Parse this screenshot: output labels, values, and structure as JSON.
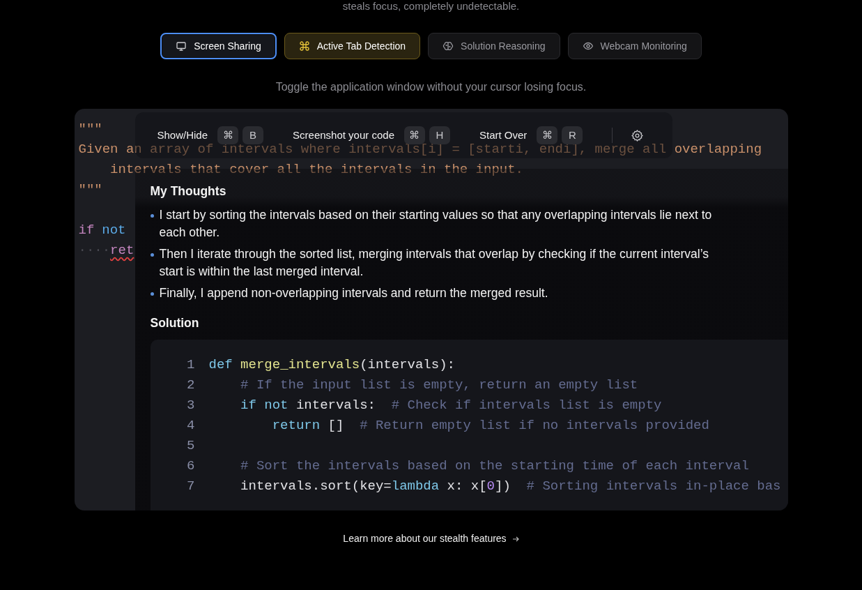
{
  "intro_tail": "steals focus, completely undetectable.",
  "tabs": [
    {
      "label": "Screen Sharing",
      "selected": false,
      "focused": true
    },
    {
      "label": "Active Tab Detection",
      "selected": true,
      "focused": false
    },
    {
      "label": "Solution Reasoning",
      "selected": false,
      "focused": false
    },
    {
      "label": "Webcam Monitoring",
      "selected": false,
      "focused": false
    }
  ],
  "caption": "Toggle the application window without your cursor losing focus.",
  "editor": {
    "docstring": [
      "\"\"\"",
      "Given an array of intervals where intervals[i] = [starti, endi], merge all overlapping",
      "    intervals that cover all the intervals in the input.",
      "\"\"\""
    ],
    "code": [
      [
        {
          "text": "if",
          "kind": "keyword2"
        },
        {
          "text": "not",
          "kind": "keyword"
        }
      ],
      [
        {
          "text": "····",
          "kind": "whitespace"
        },
        {
          "text": "ret",
          "kind": "keyword2",
          "error": true
        }
      ]
    ]
  },
  "toolbar": [
    {
      "label": "Show/Hide",
      "keys": [
        "⌘",
        "B"
      ]
    },
    {
      "label": "Screenshot your code",
      "keys": [
        "⌘",
        "H"
      ]
    },
    {
      "label": "Start Over",
      "keys": [
        "⌘",
        "R"
      ]
    }
  ],
  "thoughts": {
    "title": "My Thoughts",
    "items": [
      "I start by sorting the intervals based on their starting values so that any overlapping intervals lie next to each other.",
      "Then I iterate through the sorted list, merging intervals that overlap by checking if the current interval’s start is within the last merged interval.",
      "Finally, I append non-overlapping intervals and return the merged result."
    ]
  },
  "solution": {
    "title": "Solution",
    "lines": [
      {
        "number": "1",
        "tokens": [
          {
            "text": "def",
            "kind": "keyword"
          },
          {
            "text": " merge_intervals",
            "kind": "function"
          },
          {
            "text": "(intervals):",
            "kind": "plain"
          }
        ]
      },
      {
        "number": "2",
        "tokens": [
          {
            "text": "    # If the input list is empty, return an empty list",
            "kind": "comment"
          }
        ]
      },
      {
        "number": "3",
        "tokens": [
          {
            "text": "    if not",
            "kind": "keyword"
          },
          {
            "text": " intervals:  ",
            "kind": "plain"
          },
          {
            "text": "# Check if intervals list is empty",
            "kind": "comment"
          }
        ]
      },
      {
        "number": "4",
        "tokens": [
          {
            "text": "        return",
            "kind": "keyword"
          },
          {
            "text": " []  ",
            "kind": "plain"
          },
          {
            "text": "# Return empty list if no intervals provided",
            "kind": "comment"
          }
        ]
      },
      {
        "number": "5"
      },
      {
        "number": "6",
        "tokens": [
          {
            "text": "    # Sort the intervals based on the starting time of each interval",
            "kind": "comment"
          }
        ]
      },
      {
        "number": "7",
        "tokens": [
          {
            "text": "    intervals.sort(key=",
            "kind": "plain"
          },
          {
            "text": "lambda",
            "kind": "keyword"
          },
          {
            "text": " x: x[",
            "kind": "plain"
          },
          {
            "text": "0",
            "kind": "number"
          },
          {
            "text": "])  ",
            "kind": "plain"
          },
          {
            "text": "# Sorting intervals in-place bas",
            "kind": "comment"
          }
        ]
      }
    ]
  },
  "link": "Learn more about our stealth features"
}
